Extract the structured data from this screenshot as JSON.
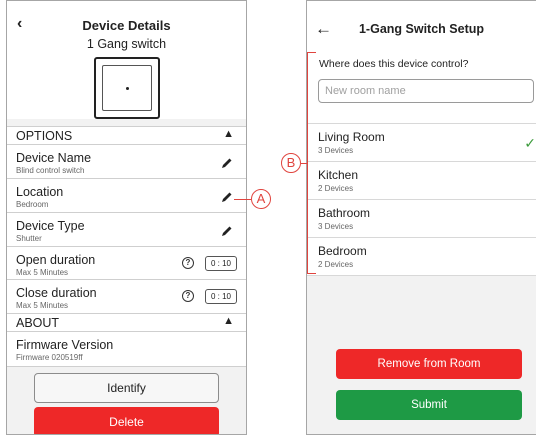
{
  "left": {
    "back_icon": "chevron-left",
    "title": "Device Details",
    "subtitle": "1 Gang switch",
    "options_label": "OPTIONS",
    "about_label": "ABOUT",
    "items": {
      "device_name": {
        "title": "Device Name",
        "sub": "Blind control switch"
      },
      "location": {
        "title": "Location",
        "sub": "Bedroom"
      },
      "device_type": {
        "title": "Device Type",
        "sub": "Shutter"
      },
      "open_duration": {
        "title": "Open duration",
        "sub": "Max 5 Minutes",
        "value": "0 : 10"
      },
      "close_duration": {
        "title": "Close duration",
        "sub": "Max 5 Minutes",
        "value": "0 : 10"
      },
      "firmware": {
        "title": "Firmware Version",
        "sub": "Firmware 020519ff"
      }
    },
    "identify_label": "Identify",
    "delete_label": "Delete",
    "callout": "A"
  },
  "right": {
    "back_icon": "arrow-left",
    "title": "1-Gang Switch Setup",
    "question": "Where does this device control?",
    "input_placeholder": "New room name",
    "rooms": [
      {
        "name": "Living Room",
        "count": "3 Devices",
        "selected": true
      },
      {
        "name": "Kitchen",
        "count": "2 Devices",
        "selected": false
      },
      {
        "name": "Bathroom",
        "count": "3 Devices",
        "selected": false
      },
      {
        "name": "Bedroom",
        "count": "2 Devices",
        "selected": false
      }
    ],
    "remove_label": "Remove from Room",
    "submit_label": "Submit",
    "callout": "B"
  },
  "colors": {
    "delete": "#ee2828",
    "submit": "#1e9a45",
    "check": "#3a9a3a",
    "callout": "#e0443e"
  },
  "icons": {
    "edit": "pencil-icon",
    "help": "question-circle-icon",
    "collapse": "chevron-up-icon",
    "check": "checkmark-icon"
  }
}
